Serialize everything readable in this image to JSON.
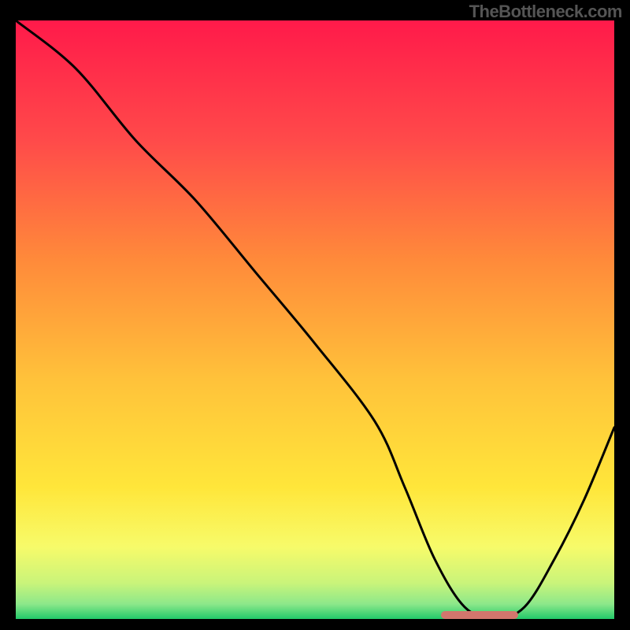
{
  "watermark": "TheBottleneck.com",
  "chart_data": {
    "type": "line",
    "title": "",
    "xlabel": "",
    "ylabel": "",
    "xlim": [
      0,
      100
    ],
    "ylim": [
      0,
      100
    ],
    "grid": false,
    "legend": false,
    "gradient_stops": [
      {
        "offset": 0.0,
        "color": "#ff1a4a"
      },
      {
        "offset": 0.2,
        "color": "#ff4a4a"
      },
      {
        "offset": 0.4,
        "color": "#ff8a3a"
      },
      {
        "offset": 0.6,
        "color": "#ffc23a"
      },
      {
        "offset": 0.78,
        "color": "#ffe63a"
      },
      {
        "offset": 0.88,
        "color": "#f7fb6a"
      },
      {
        "offset": 0.94,
        "color": "#c9f47a"
      },
      {
        "offset": 0.975,
        "color": "#8de88a"
      },
      {
        "offset": 1.0,
        "color": "#22c96a"
      }
    ],
    "series": [
      {
        "name": "bottleneck-curve",
        "x": [
          0,
          10,
          20,
          30,
          40,
          50,
          60,
          65,
          70,
          75,
          80,
          85,
          90,
          95,
          100
        ],
        "y": [
          100,
          92,
          80,
          70,
          58,
          46,
          33,
          22,
          10,
          2,
          0,
          2,
          10,
          20,
          32
        ]
      }
    ],
    "optimal_marker": {
      "x_start": 71,
      "x_end": 84,
      "y": 0.6
    }
  }
}
